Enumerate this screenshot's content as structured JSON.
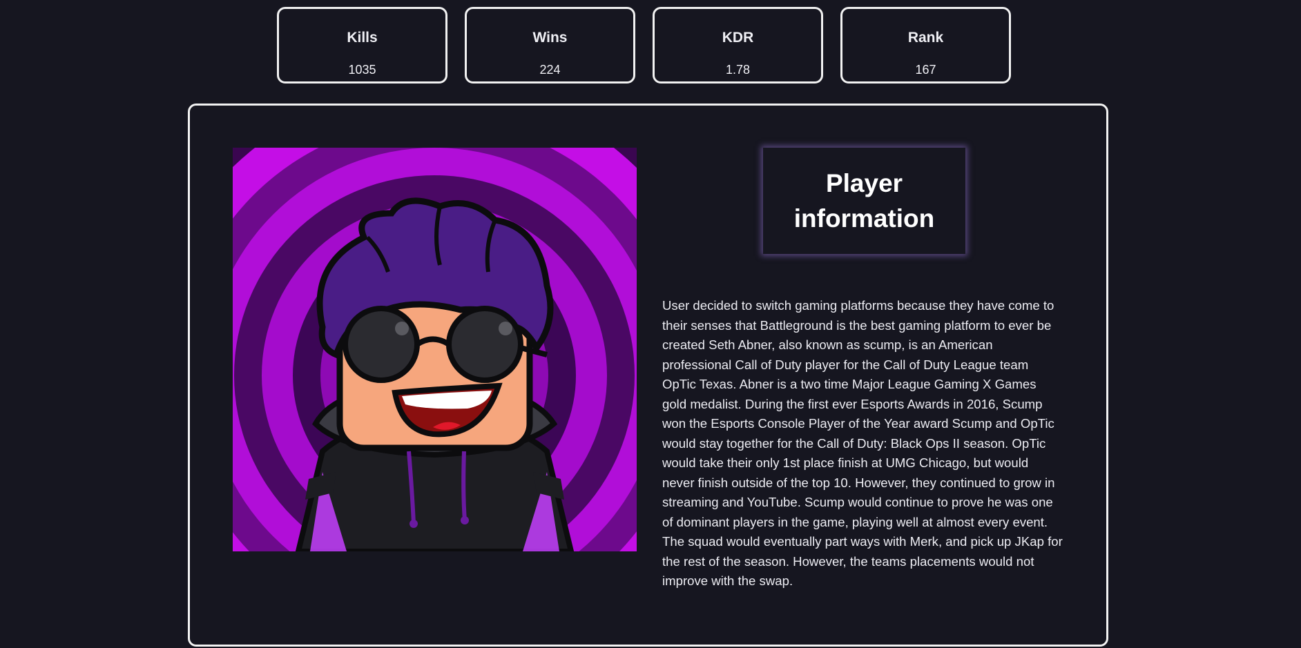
{
  "stats": [
    {
      "label": "Kills",
      "value": "1035"
    },
    {
      "label": "Wins",
      "value": "224"
    },
    {
      "label": "KDR",
      "value": "1.78"
    },
    {
      "label": "Rank",
      "value": "167"
    }
  ],
  "player": {
    "title": "Player information",
    "bio": "User decided to switch gaming platforms because they have come to their senses that Battleground is the best gaming platform to ever be created Seth Abner, also known as scump, is an American professional Call of Duty player for the Call of Duty League team OpTic Texas. Abner is a two time Major League Gaming X Games gold medalist. During the first ever Esports Awards in 2016, Scump won the Esports Console Player of the Year award Scump and OpTic would stay together for the Call of Duty: Black Ops II season. OpTic would take their only 1st place finish at UMG Chicago, but would never finish outside of the top 10. However, they continued to grow in streaming and YouTube. Scump would continue to prove he was one of dominant players in the game, playing well at almost every event. The squad would eventually part ways with Merk, and pick up JKap for the rest of the season. However, the teams placements would not improve with the swap."
  },
  "colors": {
    "background": "#161620",
    "border": "#f2f2f2",
    "accent_purple": "#b510e0"
  }
}
